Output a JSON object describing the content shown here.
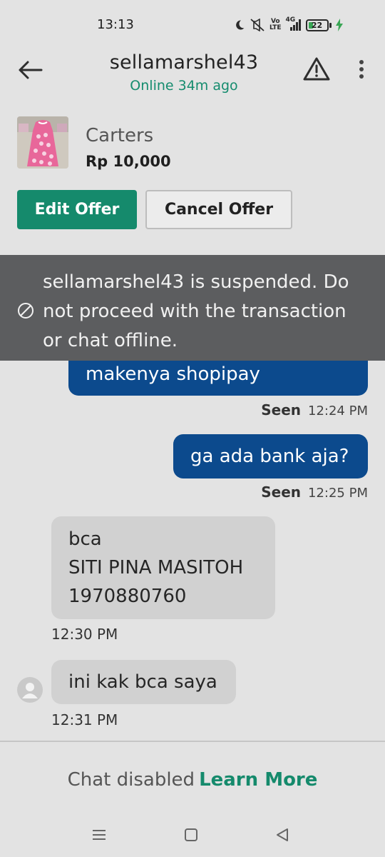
{
  "status_bar": {
    "time": "13:13",
    "network_label_top": "Vo",
    "network_label_bottom": "LTE",
    "network_type": "4G",
    "battery_level": "22",
    "icons": [
      "moon-icon",
      "mute-icon",
      "volte-icon",
      "signal-icon",
      "battery-icon",
      "charging-icon"
    ]
  },
  "header": {
    "title": "sellamarshel43",
    "subtitle": "Online 34m ago",
    "icons": [
      "back-arrow-icon",
      "warning-icon",
      "more-vertical-icon"
    ]
  },
  "product": {
    "name": "Carters",
    "price": "Rp 10,000"
  },
  "actions": {
    "edit_label": "Edit Offer",
    "cancel_label": "Cancel Offer"
  },
  "banner": {
    "text": "sellamarshel43 is suspended. Do not proceed with the transaction or chat offline.",
    "icon": "prohibited-icon"
  },
  "messages": [
    {
      "direction": "out",
      "text": "makenya shopipay",
      "status": "Seen",
      "time": "12:24 PM"
    },
    {
      "direction": "out",
      "text": "ga ada bank aja?",
      "status": "Seen",
      "time": "12:25 PM"
    },
    {
      "direction": "in",
      "lines": [
        "bca",
        "SITI PINA MASITOH",
        "1970880760"
      ],
      "time": "12:30 PM"
    },
    {
      "direction": "in",
      "text": "ini kak bca saya",
      "time": "12:31 PM"
    }
  ],
  "footer": {
    "disabled_text": "Chat disabled",
    "learn_more": "Learn More"
  },
  "nav": {
    "icons": [
      "recents-icon",
      "home-icon",
      "back-icon"
    ]
  },
  "colors": {
    "accent": "#158a6c",
    "outgoing_bubble": "#0c4a8d",
    "incoming_bubble": "#d1d1d1",
    "banner": "#5c5d5f",
    "background": "#e3e3e3"
  }
}
